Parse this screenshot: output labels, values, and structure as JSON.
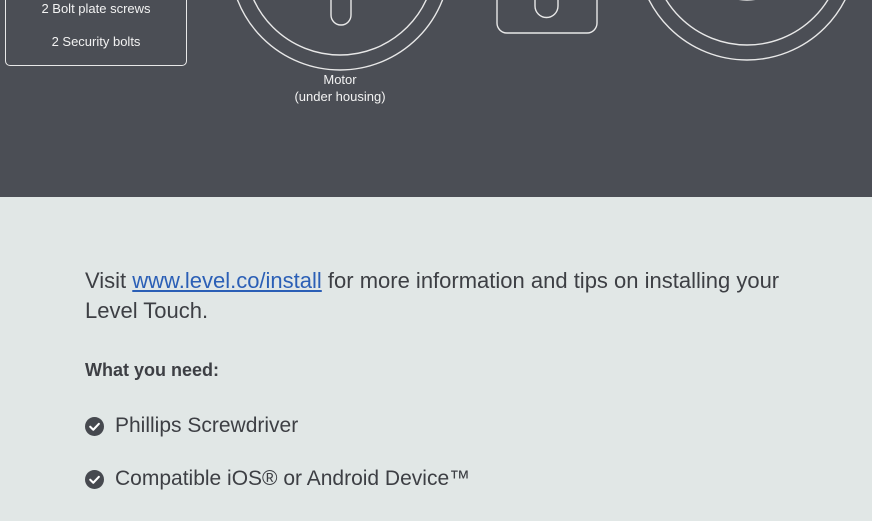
{
  "parts_box": {
    "items": [
      "2 Bolt plate screws",
      "2 Security bolts"
    ]
  },
  "motor_label": {
    "line1": "Motor",
    "line2": "(under housing)"
  },
  "info": {
    "prefix": "Visit ",
    "link_text": "www.level.co/install",
    "suffix": " for more information and tips on installing your Level Touch."
  },
  "requirements": {
    "title": "What you need:",
    "items": [
      "Phillips Screwdriver",
      "Compatible iOS® or Android Device™"
    ]
  },
  "colors": {
    "dark_panel": "#4b4e55",
    "light_panel": "#e1e7e6",
    "text": "#3d3f44",
    "link": "#2b5fb6",
    "check": "#46494f"
  }
}
